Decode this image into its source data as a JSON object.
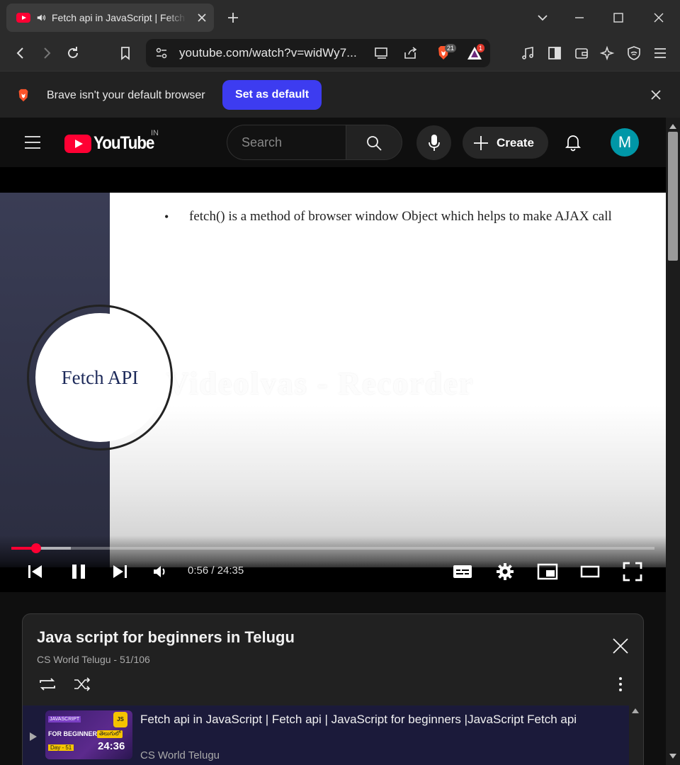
{
  "browser": {
    "tab_title": "Fetch api in JavaScript | Fetch api | JavaScript for beginners |JavaScript Fetch api",
    "url": "youtube.com/watch?v=widWy7...",
    "shields_count": "21",
    "rewards_count": "1",
    "infobar_message": "Brave isn't your default browser",
    "set_default_label": "Set as default"
  },
  "youtube": {
    "logo_text": "YouTube",
    "country_code": "IN",
    "search_placeholder": "Search",
    "create_label": "Create",
    "avatar_letter": "M"
  },
  "video": {
    "bullet": "•",
    "slide_text": "fetch() is a method of browser window Object which helps to make AJAX call",
    "circle_text": "Fetch API",
    "watermark": "Videolvas - Recorder",
    "time_display": "0:56 / 24:35",
    "progress_played_fraction": 0.038,
    "progress_loaded_fraction": 0.093
  },
  "playlist": {
    "title": "Java script for beginners in Telugu",
    "meta": "CS World Telugu - 51/106",
    "current_item": {
      "title": "Fetch api in JavaScript | Fetch api | JavaScript for beginners |JavaScript Fetch api",
      "channel": "CS World Telugu",
      "thumb_tag": "JAVASCRIPT",
      "thumb_heading": "FOR BEGINNERS",
      "thumb_day": "Day - 51",
      "thumb_logo": "JS",
      "thumb_lang": "తెలుగులో",
      "duration": "24:36"
    }
  },
  "colors": {
    "youtube_red": "#ff0033",
    "brave_blue": "#3d3cf0",
    "avatar": "#0097a7"
  }
}
